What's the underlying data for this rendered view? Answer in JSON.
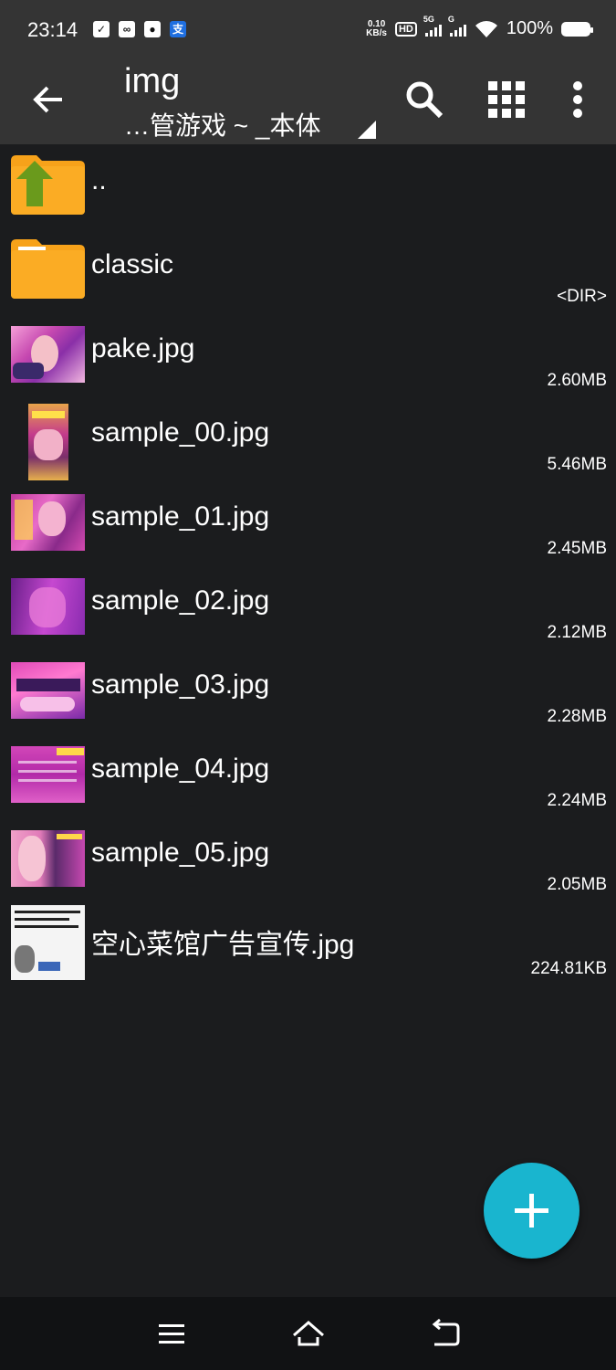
{
  "status_bar": {
    "time": "23:14",
    "net_speed_value": "0.10",
    "net_speed_unit": "KB/s",
    "hd_label": "HD",
    "sig1_label": "5G",
    "sig2_label": "G",
    "battery_pct": "100%",
    "app_icons": [
      "clipboard-icon",
      "baidu-netdisk-icon",
      "wechat-icon",
      "alipay-icon"
    ],
    "alipay_glyph": "支"
  },
  "toolbar": {
    "title": "img",
    "subtitle": "…管游戏 ~ _本体"
  },
  "files": [
    {
      "name": "..",
      "meta": "",
      "kind": "parent-folder"
    },
    {
      "name": "classic",
      "meta": "<DIR>",
      "kind": "folder"
    },
    {
      "name": "pake.jpg",
      "meta": "2.60MB",
      "kind": "image"
    },
    {
      "name": "sample_00.jpg",
      "meta": "5.46MB",
      "kind": "image-portrait"
    },
    {
      "name": "sample_01.jpg",
      "meta": "2.45MB",
      "kind": "image"
    },
    {
      "name": "sample_02.jpg",
      "meta": "2.12MB",
      "kind": "image"
    },
    {
      "name": "sample_03.jpg",
      "meta": "2.28MB",
      "kind": "image"
    },
    {
      "name": "sample_04.jpg",
      "meta": "2.24MB",
      "kind": "image"
    },
    {
      "name": "sample_05.jpg",
      "meta": "2.05MB",
      "kind": "image"
    },
    {
      "name": "空心菜馆广告宣传.jpg",
      "meta": "224.81KB",
      "kind": "image"
    }
  ],
  "colors": {
    "toolbar_bg": "#343434",
    "list_bg": "#1b1c1e",
    "folder": "#f7a21a",
    "up_arrow": "#6a9a1c",
    "fab": "#19b5cf",
    "thumb_pink": "#d646b8"
  }
}
